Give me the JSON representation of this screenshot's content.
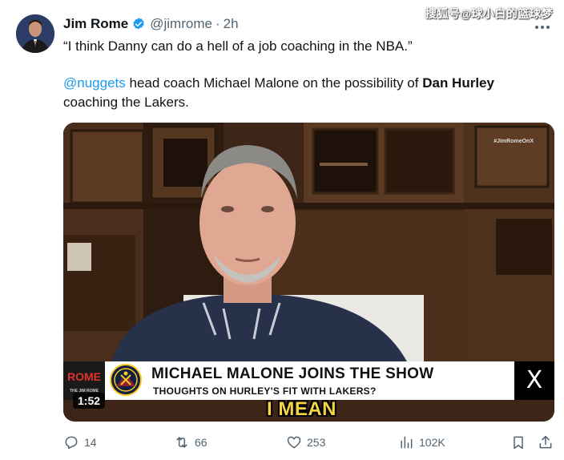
{
  "watermark": "搜狐号@球小白的篮球梦",
  "tweet": {
    "author_name": "Jim Rome",
    "handle": "@jimrome",
    "separator": "·",
    "time": "2h",
    "quote": "“I think Danny can do a hell of a job coaching in the NBA.”",
    "mention": "@nuggets",
    "body_part1": " head coach Michael Malone on the possibility of ",
    "body_bold": "Dan Hurley",
    "body_part2": " coaching the Lakers."
  },
  "video": {
    "corner_tag": "#JimRomeOnX",
    "logo_text": "ROME",
    "logo_subtext": "THE JIM ROME SHOW",
    "lower_third_title": "MICHAEL MALONE JOINS THE SHOW",
    "lower_third_subtitle": "THOUGHTS ON HURLEY'S FIT WITH LAKERS?",
    "x_logo": "X",
    "duration": "1:52",
    "caption": "I MEAN"
  },
  "actions": {
    "replies": "14",
    "reposts": "66",
    "likes": "253",
    "views": "102K"
  },
  "icons": {
    "verified": "verified-badge-icon",
    "more": "more-icon",
    "reply": "reply-icon",
    "repost": "repost-icon",
    "like": "heart-icon",
    "views": "views-chart-icon",
    "bookmark": "bookmark-icon",
    "share": "share-icon"
  },
  "colors": {
    "accent": "#1d9bf0",
    "secondary_text": "#536471",
    "caption_yellow": "#f5d442",
    "nuggets_gold": "#fec524",
    "nuggets_navy": "#0e2240"
  }
}
